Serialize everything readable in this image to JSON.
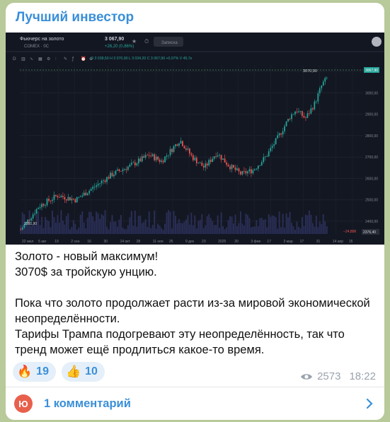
{
  "channel": {
    "name": "Лучший инвестор"
  },
  "chart": {
    "instrument_name": "Фьючерс на золото",
    "exchange": "COMEX · 0C",
    "price": "3 067,90",
    "change": "+26,20 (0,86%)",
    "tab_label": "Записка",
    "ohlc": "O 3 038,50  H 3 070,90  L 3 034,20  C 3 067,90  +0,97%  V 45,7к",
    "last_label": "3070,90",
    "current_label": "3067,90",
    "low_label": "2351,90",
    "volume_label": "−24,89К",
    "volume_box": "2376,40",
    "y_ticks": [
      "3100,00",
      "3000,00",
      "2900,00",
      "2800,00",
      "2700,00",
      "2600,00",
      "2500,00",
      "2400,00"
    ],
    "x_ticks": [
      "22 июл",
      "5 авг",
      "19",
      "2 сен",
      "16",
      "30",
      "14 окт",
      "28",
      "11 ноя",
      "25",
      "9 дек",
      "23",
      "2025",
      "20",
      "3 фев",
      "17",
      "3 мар",
      "17",
      "31",
      "14 апр",
      "15"
    ],
    "toolbar_icons": [
      "d-icon",
      "candle-icon",
      "line-icon",
      "trash-icon",
      "gear-icon",
      "chart-icon",
      "draw-icon",
      "fx-icon",
      "alert-icon",
      "compare-icon"
    ],
    "colors": {
      "up": "#26a69a",
      "down": "#ef5350",
      "bg": "#131722",
      "volume": "#2a2e55"
    }
  },
  "message": {
    "lines": [
      "Золото - новый максимум!",
      "3070$ за тройскую унцию.",
      "",
      "Пока что золото продолжает расти из-за мировой экономической неопределённости.",
      "Тарифы Трампа подогревают эту неопределённость, так что тренд может ещё продлиться какое-то время."
    ]
  },
  "reactions": [
    {
      "emoji": "🔥",
      "count": "19"
    },
    {
      "emoji": "👍",
      "count": "10"
    }
  ],
  "meta": {
    "views": "2573",
    "time": "18:22"
  },
  "comments": {
    "avatar_letter": "Ю",
    "label": "1 комментарий"
  }
}
